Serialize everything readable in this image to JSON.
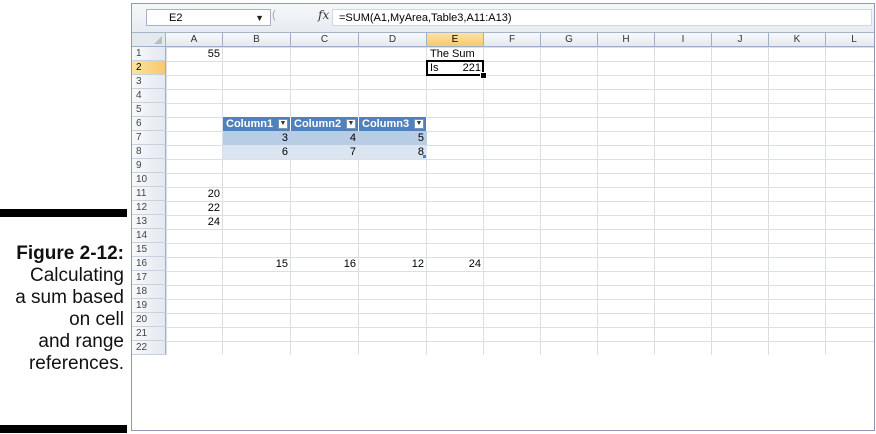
{
  "caption": {
    "figure": "Figure 2-12:",
    "lines": [
      "Calculating",
      "a sum based",
      "on cell",
      "and range",
      "references."
    ]
  },
  "formula_bar": {
    "name_box": "E2",
    "formula": "=SUM(A1,MyArea,Table3,A11:A13)",
    "fx_label": "fx"
  },
  "columns": [
    "A",
    "B",
    "C",
    "D",
    "E",
    "F",
    "G",
    "H",
    "I",
    "J",
    "K",
    "L"
  ],
  "rows": [
    "1",
    "2",
    "3",
    "4",
    "5",
    "6",
    "7",
    "8",
    "9",
    "10",
    "11",
    "12",
    "13",
    "14",
    "15",
    "16",
    "17",
    "18",
    "19",
    "20",
    "21",
    "22"
  ],
  "selected": {
    "column": "E",
    "row": "2"
  },
  "cells": {
    "A1": "55",
    "E1": "The Sum Is",
    "E2": "221",
    "A11": "20",
    "A12": "22",
    "A13": "24",
    "B16": "15",
    "C16": "16",
    "D16": "12",
    "E16": "24"
  },
  "table": {
    "headers": [
      "Column1",
      "Column2",
      "Column3"
    ],
    "rows": [
      [
        "3",
        "4",
        "5"
      ],
      [
        "6",
        "7",
        "8"
      ]
    ],
    "colors": {
      "header": "#4f81bd",
      "band1": "#b8cce4",
      "band2": "#dbe5f1"
    }
  },
  "colors": {
    "selected_header": "#f8c96a",
    "grid": "#dadfe6"
  }
}
